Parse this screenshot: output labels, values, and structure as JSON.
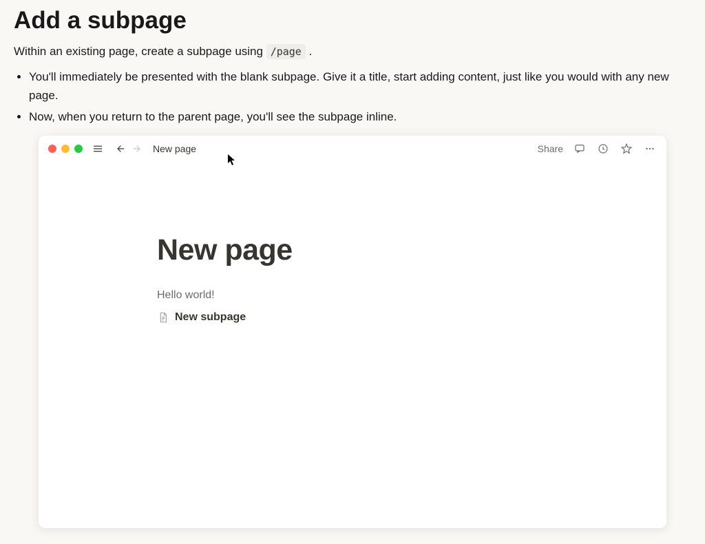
{
  "section": {
    "title": "Add a subpage",
    "intro_prefix": "Within an existing page, create a subpage using ",
    "intro_code": "/page",
    "intro_suffix": " .",
    "bullets": [
      "You'll immediately be presented with the blank subpage. Give it a title, start adding content, just like you would with any new page.",
      "Now, when you return to the parent page, you'll see the subpage inline."
    ]
  },
  "window": {
    "breadcrumb": "New page",
    "share_label": "Share",
    "page_title": "New page",
    "content_text": "Hello world!",
    "subpage_title": "New subpage"
  }
}
